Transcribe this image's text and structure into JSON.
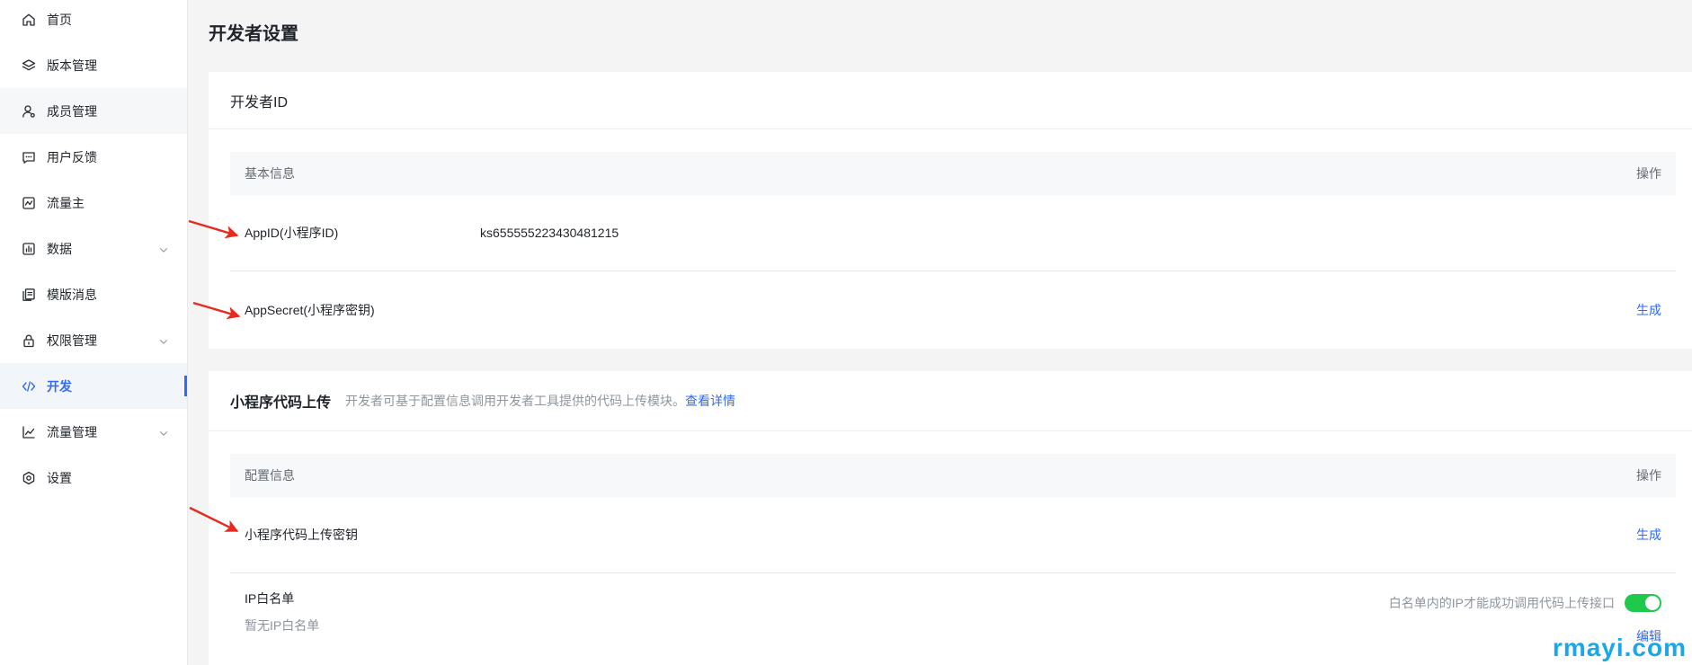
{
  "sidebar": {
    "items": [
      {
        "label": "首页",
        "icon": "home-icon"
      },
      {
        "label": "版本管理",
        "icon": "layers-icon"
      },
      {
        "label": "成员管理",
        "icon": "user-icon",
        "hovered": true
      },
      {
        "label": "用户反馈",
        "icon": "message-icon"
      },
      {
        "label": "流量主",
        "icon": "traffic-owner-icon"
      },
      {
        "label": "数据",
        "icon": "data-chart-icon",
        "expandable": true
      },
      {
        "label": "模版消息",
        "icon": "template-icon"
      },
      {
        "label": "权限管理",
        "icon": "lock-icon",
        "expandable": true
      },
      {
        "label": "开发",
        "icon": "code-icon",
        "active": true
      },
      {
        "label": "流量管理",
        "icon": "line-chart-icon",
        "expandable": true
      },
      {
        "label": "设置",
        "icon": "gear-icon"
      }
    ]
  },
  "page": {
    "title": "开发者设置"
  },
  "developer_id": {
    "title": "开发者ID",
    "table": {
      "col_info": "基本信息",
      "col_action": "操作"
    },
    "app_id": {
      "label": "AppID(小程序ID)",
      "value": "ks655555223430481215"
    },
    "app_secret": {
      "label": "AppSecret(小程序密钥)",
      "action": "生成"
    }
  },
  "code_upload": {
    "title": "小程序代码上传",
    "description": "开发者可基于配置信息调用开发者工具提供的代码上传模块。",
    "details_link": "查看详情",
    "table": {
      "col_info": "配置信息",
      "col_action": "操作"
    },
    "upload_key": {
      "label": "小程序代码上传密钥",
      "action": "生成"
    },
    "ip_whitelist": {
      "label": "IP白名单",
      "empty_text": "暂无IP白名单",
      "hint": "白名单内的IP才能成功调用代码上传接口",
      "enabled": true,
      "edit": "编辑"
    }
  },
  "watermark": {
    "text": "rmayi.com"
  },
  "colors": {
    "accent": "#2f6bf4",
    "toggle_on": "#1fc94b",
    "annotation_arrow": "#e62a1e",
    "watermark": "#1aa7e8"
  }
}
